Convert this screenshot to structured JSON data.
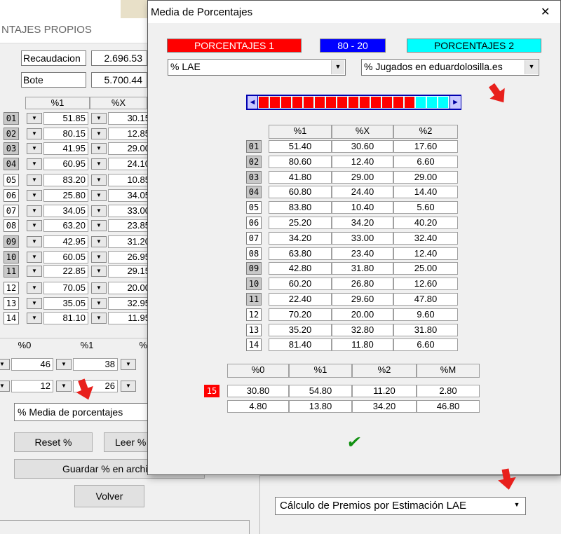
{
  "bg": {
    "title": "NTAJES PROPIOS",
    "recaudacion_label": "Recaudacion",
    "recaudacion_value": "2.696.53",
    "bote_label": "Bote",
    "bote_value": "5.700.44",
    "col_headers": [
      "%1",
      "%X"
    ],
    "rows": [
      {
        "n": "01",
        "v1": "51.85",
        "v2": "30.15"
      },
      {
        "n": "02",
        "v1": "80.15",
        "v2": "12.85"
      },
      {
        "n": "03",
        "v1": "41.95",
        "v2": "29.00"
      },
      {
        "n": "04",
        "v1": "60.95",
        "v2": "24.10"
      },
      {
        "n": "05",
        "v1": "83.20",
        "v2": "10.85"
      },
      {
        "n": "06",
        "v1": "25.80",
        "v2": "34.05"
      },
      {
        "n": "07",
        "v1": "34.05",
        "v2": "33.00"
      },
      {
        "n": "08",
        "v1": "63.20",
        "v2": "23.85"
      },
      {
        "n": "09",
        "v1": "42.95",
        "v2": "31.20"
      },
      {
        "n": "10",
        "v1": "60.05",
        "v2": "26.95"
      },
      {
        "n": "11",
        "v1": "22.85",
        "v2": "29.15"
      },
      {
        "n": "12",
        "v1": "70.05",
        "v2": "20.00"
      },
      {
        "n": "13",
        "v1": "35.05",
        "v2": "32.95"
      },
      {
        "n": "14",
        "v1": "81.10",
        "v2": "11.95"
      }
    ],
    "sub_headers": [
      "%0",
      "%1",
      "%"
    ],
    "sub_row1": [
      "46",
      "38"
    ],
    "sub_row2": [
      "12",
      "26"
    ],
    "media_select": "% Media de porcentajes",
    "reset_button": "Reset %",
    "leer_button": "Leer %",
    "guardar_button": "Guardar % en archi",
    "volver_button": "Volver",
    "calc_select": "Cálculo de Premios por Estimación LAE"
  },
  "modal": {
    "title": "Media de Porcentajes",
    "close_glyph": "✕",
    "legend": [
      {
        "label": "PORCENTAJES 1",
        "bg": "#ff0000",
        "fg": "#ffffff"
      },
      {
        "label": "80 - 20",
        "bg": "#0000ff",
        "fg": "#ffffff"
      },
      {
        "label": "PORCENTAJES 2",
        "bg": "#00ffff",
        "fg": "#000000"
      }
    ],
    "select_left": "% LAE",
    "select_right": "% Jugados en eduardolosilla.es",
    "slider": {
      "red_fraction": 0.8,
      "left_glyph": "◄",
      "right_glyph": "►"
    },
    "col_headers": [
      "%1",
      "%X",
      "%2"
    ],
    "rows": [
      {
        "n": "01",
        "c1": "51.40",
        "cx": "30.60",
        "c2": "17.60",
        "g": true
      },
      {
        "n": "02",
        "c1": "80.60",
        "cx": "12.40",
        "c2": "6.60",
        "g": true
      },
      {
        "n": "03",
        "c1": "41.80",
        "cx": "29.00",
        "c2": "29.00",
        "g": true
      },
      {
        "n": "04",
        "c1": "60.80",
        "cx": "24.40",
        "c2": "14.40",
        "g": true
      },
      {
        "n": "05",
        "c1": "83.80",
        "cx": "10.40",
        "c2": "5.60",
        "g": false
      },
      {
        "n": "06",
        "c1": "25.20",
        "cx": "34.20",
        "c2": "40.20",
        "g": false
      },
      {
        "n": "07",
        "c1": "34.20",
        "cx": "33.00",
        "c2": "32.40",
        "g": false
      },
      {
        "n": "08",
        "c1": "63.80",
        "cx": "23.40",
        "c2": "12.40",
        "g": false
      },
      {
        "n": "09",
        "c1": "42.80",
        "cx": "31.80",
        "c2": "25.00",
        "g": true
      },
      {
        "n": "10",
        "c1": "60.20",
        "cx": "26.80",
        "c2": "12.60",
        "g": true
      },
      {
        "n": "11",
        "c1": "22.40",
        "cx": "29.60",
        "c2": "47.80",
        "g": true
      },
      {
        "n": "12",
        "c1": "70.20",
        "cx": "20.00",
        "c2": "9.60",
        "g": false
      },
      {
        "n": "13",
        "c1": "35.20",
        "cx": "32.80",
        "c2": "31.80",
        "g": false
      },
      {
        "n": "14",
        "c1": "81.40",
        "cx": "11.80",
        "c2": "6.60",
        "g": false
      }
    ],
    "p15_headers": [
      "%0",
      "%1",
      "%2",
      "%M"
    ],
    "p15_label": "15",
    "p15_row1": [
      "30.80",
      "54.80",
      "11.20",
      "2.80"
    ],
    "p15_row2": [
      "4.80",
      "13.80",
      "34.20",
      "46.80"
    ],
    "ok_glyph": "✔",
    "accent_red": "#e8201c"
  }
}
